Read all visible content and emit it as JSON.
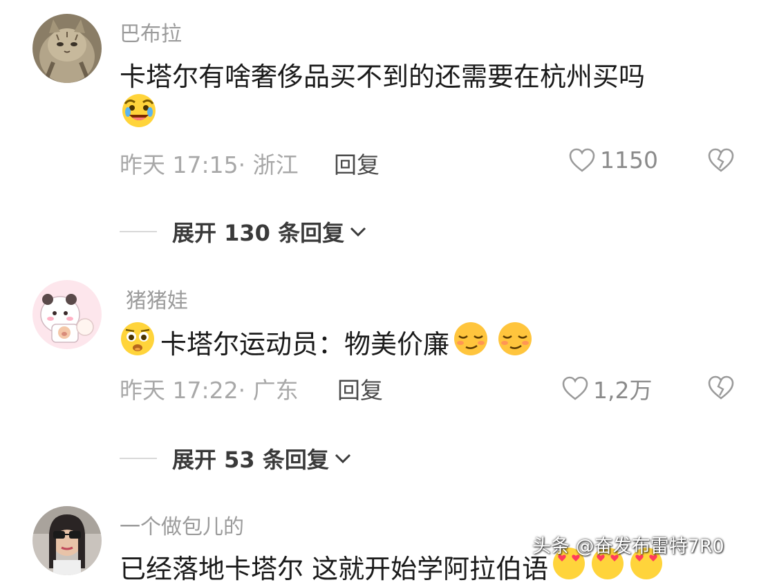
{
  "comments": [
    {
      "username": "巴布拉",
      "text": "卡塔尔有啥奢侈品买不到的还需要在杭州买吗",
      "time_location": "昨天 17:15· 浙江",
      "reply_label": "回复",
      "likes": "1150",
      "expand_label": "展开 130 条回复"
    },
    {
      "username": "猪猪娃",
      "text": "卡塔尔运动员：物美价廉",
      "time_location": "昨天 17:22· 广东",
      "reply_label": "回复",
      "likes": "1,2万",
      "expand_label": "展开 53 条回复"
    },
    {
      "username": "一个做包儿的",
      "text": "已经落地卡塔尔 这就开始学阿拉伯语"
    }
  ],
  "watermark": "头条 @奋发布雷特7R0",
  "icons": {
    "like": "heart-outline-icon",
    "dislike": "broken-heart-icon",
    "expand": "chevron-down-icon"
  },
  "colors": {
    "username": "#9b9b9b",
    "meta": "#a8a8a8",
    "text": "#1a1a1a"
  }
}
